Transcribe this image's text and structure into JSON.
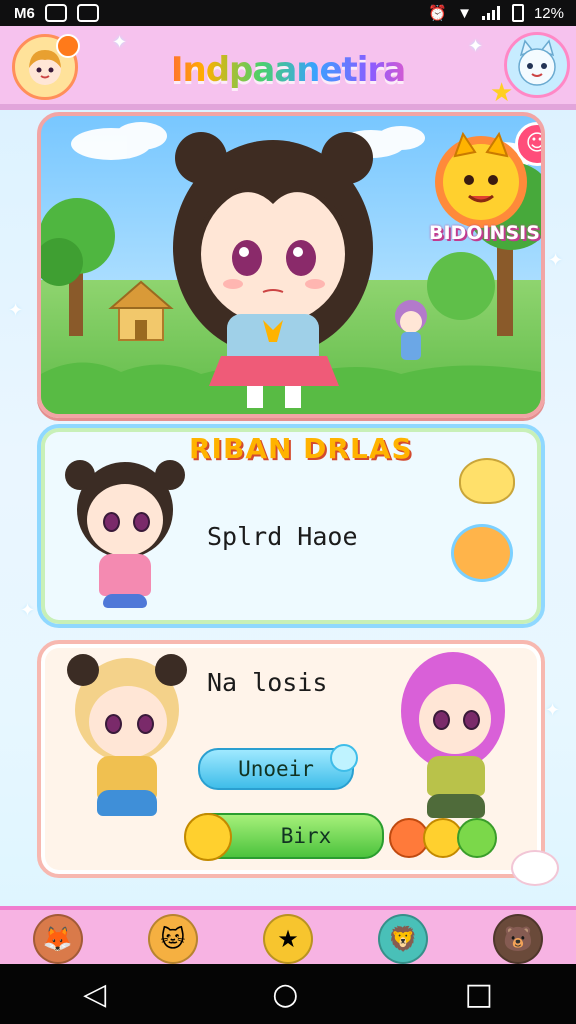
{
  "status_bar": {
    "carrier": "M6",
    "battery_text": "12%"
  },
  "header": {
    "app_title": "Indpaanetira"
  },
  "hero": {
    "badge_label": "BIDOINSIS"
  },
  "card_two": {
    "title": "RIBAN DRLAS",
    "label": "Splrd Haoe"
  },
  "card_three": {
    "title": "Na losis",
    "blue_button_label": "Unoeir",
    "green_button_label": "Birx"
  },
  "colors": {
    "header_bg": "#f6c2ee",
    "accent_orange": "#ffb300",
    "pill_blue": "#3fbde9",
    "pill_green": "#4cc33d",
    "nav_bg": "#f7b3e3"
  },
  "icons": {
    "status_left": [
      "notification-icon",
      "photo-icon",
      "message-icon"
    ],
    "status_right": [
      "alarm-icon",
      "wifi-icon",
      "signal-icon",
      "battery-icon"
    ],
    "bottom_nav": [
      "fox-icon",
      "cat-icon",
      "star-icon",
      "lion-icon",
      "bear-icon"
    ],
    "system_nav": [
      "back-icon",
      "home-icon",
      "recents-icon"
    ]
  }
}
